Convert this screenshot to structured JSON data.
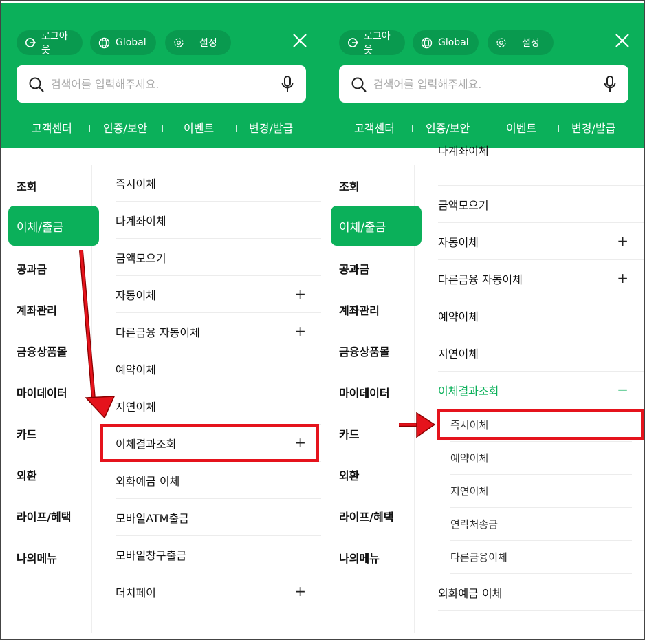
{
  "header": {
    "logout_label": "로그아웃",
    "global_label": "Global",
    "settings_label": "설정",
    "search_placeholder": "검색어를 입력해주세요.",
    "quick_links": [
      "고객센터",
      "인증/보안",
      "이벤트",
      "변경/발급"
    ]
  },
  "categories": [
    "조회",
    "이체/출금",
    "공과금",
    "계좌관리",
    "금융상품몰",
    "마이데이터",
    "카드",
    "외환",
    "라이프/혜택",
    "나의메뉴"
  ],
  "left_items": [
    {
      "label": "즉시이체",
      "expand": ""
    },
    {
      "label": "다계좌이체",
      "expand": ""
    },
    {
      "label": "금액모으기",
      "expand": ""
    },
    {
      "label": "자동이체",
      "expand": "+"
    },
    {
      "label": "다른금융 자동이체",
      "expand": "+"
    },
    {
      "label": "예약이체",
      "expand": ""
    },
    {
      "label": "지연이체",
      "expand": ""
    },
    {
      "label": "이체결과조회",
      "expand": "+"
    },
    {
      "label": "외화예금 이체",
      "expand": ""
    },
    {
      "label": "모바일ATM출금",
      "expand": ""
    },
    {
      "label": "모바일창구출금",
      "expand": ""
    },
    {
      "label": "더치페이",
      "expand": "+"
    }
  ],
  "right_items": [
    {
      "label": "다계좌이체",
      "expand": ""
    },
    {
      "label": "금액모으기",
      "expand": ""
    },
    {
      "label": "자동이체",
      "expand": "+"
    },
    {
      "label": "다른금융 자동이체",
      "expand": "+"
    },
    {
      "label": "예약이체",
      "expand": ""
    },
    {
      "label": "지연이체",
      "expand": ""
    },
    {
      "label": "이체결과조회",
      "expand": "−"
    }
  ],
  "right_subitems": [
    "즉시이체",
    "예약이체",
    "지연이체",
    "연락처송금",
    "다른금융이체"
  ],
  "right_after": {
    "label": "외화예금 이체"
  },
  "colors": {
    "brand_green": "#0bb05a",
    "highlight_red": "#e5131c"
  }
}
